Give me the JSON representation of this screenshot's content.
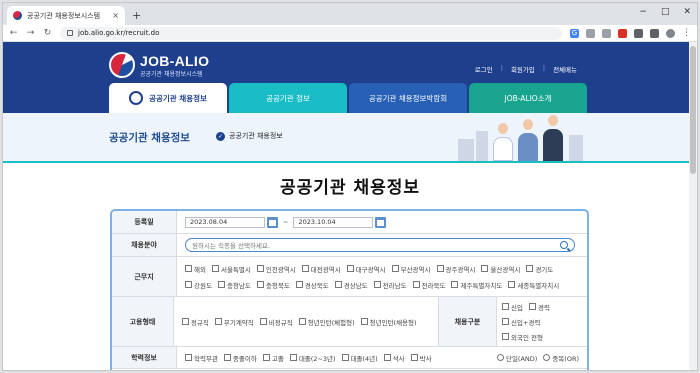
{
  "browser": {
    "tab_title": "공공기관 채용정보시스템",
    "tab_close": "×",
    "new_tab": "+",
    "win_min": "−",
    "win_max": "□",
    "win_close": "✕",
    "url": "job.alio.go.kr/recruit.do",
    "ext_label": "G"
  },
  "site": {
    "logo_title": "JOB-ALIO",
    "logo_sub": "공공기관 채용정보시스템",
    "top_links": [
      "로그인",
      "회원가입",
      "전체메뉴"
    ],
    "nav": [
      "공공기관 채용정보",
      "공공기관 정보",
      "공공기관 채용정보박람회",
      "JOB-ALIO소개"
    ]
  },
  "banner": {
    "title": "공공기관 채용정보",
    "breadcrumb": "공공기관 채용정보"
  },
  "page_title": "공공기관 채용정보",
  "form": {
    "date": {
      "label": "등록일",
      "start": "2023.08.04",
      "end": "2023.10.04",
      "sep": "~"
    },
    "field": {
      "label": "채용분야",
      "placeholder": "원하시는 직종을 선택하세요."
    },
    "region": {
      "label": "근무지",
      "options": [
        "해외",
        "서울특별시",
        "인천광역시",
        "대전광역시",
        "대구광역시",
        "부산광역시",
        "광주광역시",
        "울산광역시",
        "경기도",
        "강원도",
        "충청남도",
        "충청북도",
        "경상북도",
        "경상남도",
        "전라남도",
        "전라북도",
        "제주특별자치도",
        "세종특별자치시"
      ]
    },
    "employment": {
      "label": "고용형태",
      "options": [
        "정규직",
        "무기계약직",
        "비정규직",
        "청년인턴(체험형)",
        "청년인턴(채용형)"
      ]
    },
    "recruit_type": {
      "label": "채용구분",
      "options": [
        "신입",
        "경력",
        "신입+경력",
        "외국인 전형"
      ]
    },
    "education": {
      "label": "학력정보",
      "options": [
        "학력무관",
        "중졸이하",
        "고졸",
        "대졸(2~3년)",
        "대졸(4년)",
        "석사",
        "박사"
      ],
      "radios": [
        "단일(AND)",
        "중복(OR)"
      ]
    }
  }
}
